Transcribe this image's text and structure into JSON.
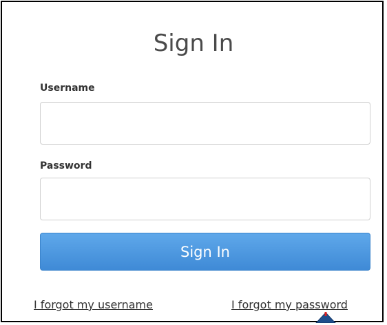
{
  "form": {
    "title": "Sign In",
    "username_label": "Username",
    "username_value": "",
    "password_label": "Password",
    "password_value": "",
    "submit_label": "Sign In"
  },
  "links": {
    "forgot_username": "I forgot my username",
    "forgot_password": "I forgot my password"
  },
  "colors": {
    "button_blue": "#4a94dd",
    "annotation_arrow": "#1f4e8c",
    "annotation_dot": "#e02020"
  },
  "annotation": {
    "icon": "pointer-arrow-icon"
  }
}
